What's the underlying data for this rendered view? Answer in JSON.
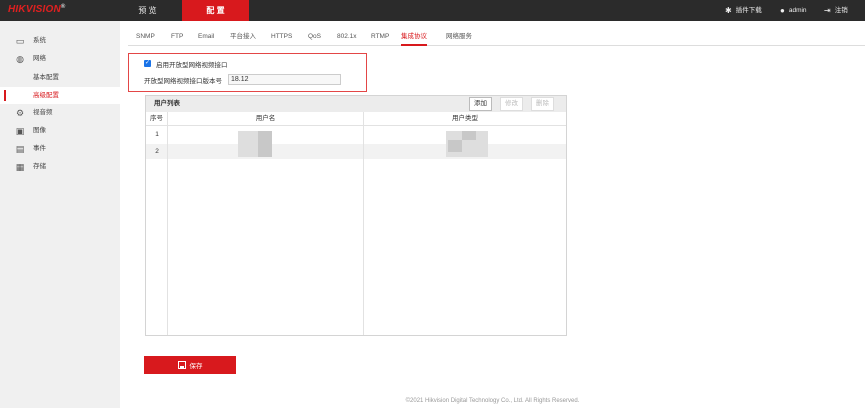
{
  "brand": {
    "name": "HIKVISION",
    "reg": "®"
  },
  "nav": {
    "preview": "预 览",
    "config": "配 置"
  },
  "top_right": {
    "plugin": "插件下载",
    "user": "admin",
    "logout": "注销"
  },
  "sidebar": {
    "items": [
      {
        "label": "系统",
        "icon": "monitor-icon"
      },
      {
        "label": "网络",
        "icon": "globe-icon"
      },
      {
        "label": "视音频",
        "icon": "camera-icon"
      },
      {
        "label": "图像",
        "icon": "image-icon"
      },
      {
        "label": "事件",
        "icon": "calendar-icon"
      },
      {
        "label": "存储",
        "icon": "save-icon"
      }
    ],
    "sub_items": [
      {
        "label": "基本配置"
      },
      {
        "label": "高级配置"
      }
    ]
  },
  "tabs": [
    "SNMP",
    "FTP",
    "Email",
    "平台接入",
    "HTTPS",
    "QoS",
    "802.1x",
    "RTMP",
    "集成协议",
    "网络服务"
  ],
  "active_tab": "集成协议",
  "integration": {
    "enable_label": "启用开放型网络视频接口",
    "enabled": true,
    "version_label": "开放型网络视频接口版本号",
    "version_value": "18.12"
  },
  "user_list": {
    "title": "用户列表",
    "add": "添加",
    "modify": "修改",
    "delete": "删除",
    "columns": [
      "序号",
      "用户名",
      "用户类型"
    ],
    "rows": [
      {
        "no": "1"
      },
      {
        "no": "2"
      }
    ]
  },
  "save_label": "保存",
  "footer": "©2021 Hikvision Digital Technology Co., Ltd. All Rights Reserved.",
  "colors": {
    "accent": "#d8191d",
    "highlight_border": "#e34646",
    "checkbox": "#1a73e8"
  }
}
